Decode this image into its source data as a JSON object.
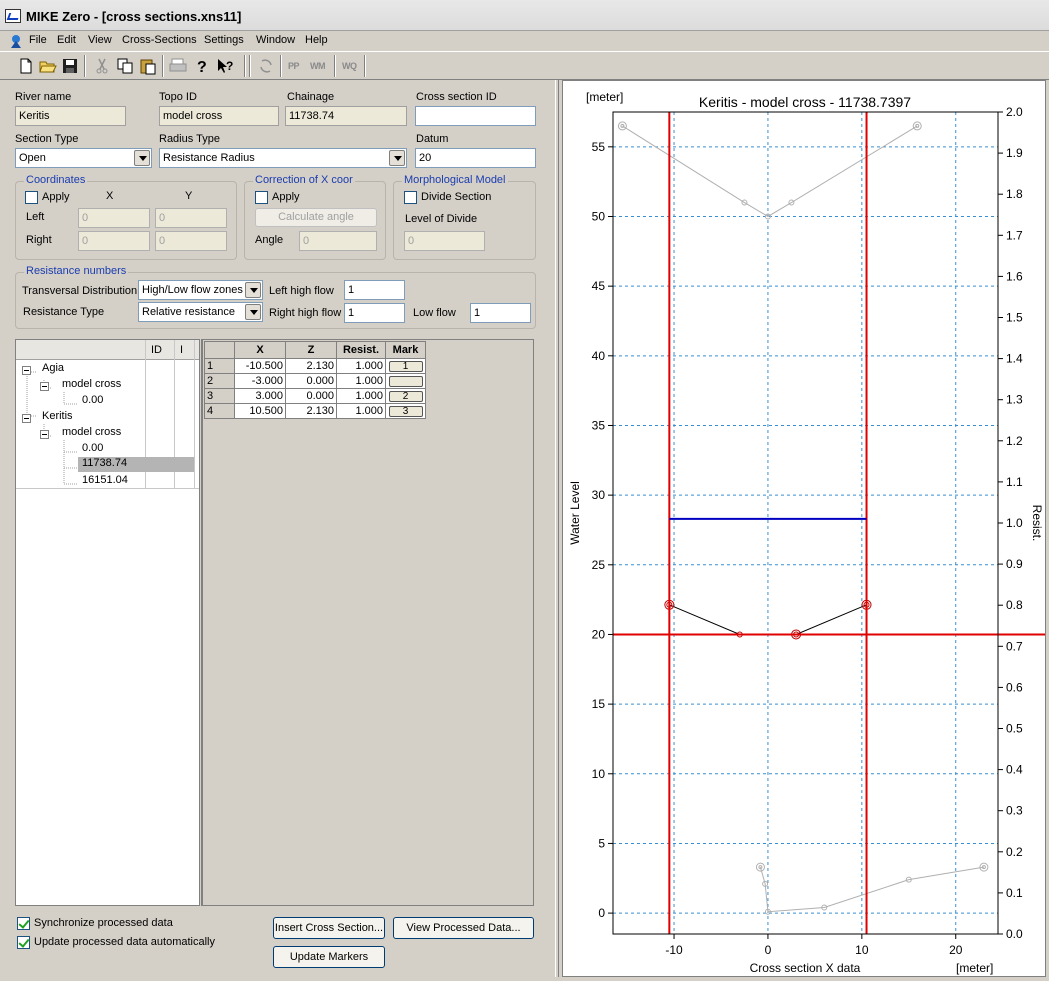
{
  "window": {
    "title": "MIKE Zero - [cross sections.xns11]"
  },
  "menu": [
    "File",
    "Edit",
    "View",
    "Cross-Sections",
    "Settings",
    "Window",
    "Help"
  ],
  "toolbar": {
    "labels": [
      "PP",
      "WM",
      "WQ"
    ]
  },
  "form": {
    "river_name": {
      "label": "River name",
      "value": "Keritis"
    },
    "topo_id": {
      "label": "Topo ID",
      "value": "model cross"
    },
    "chainage": {
      "label": "Chainage",
      "value": "11738.74"
    },
    "cross_section_id": {
      "label": "Cross section ID",
      "value": ""
    },
    "section_type": {
      "label": "Section Type",
      "value": "Open"
    },
    "radius_type": {
      "label": "Radius Type",
      "value": "Resistance Radius"
    },
    "datum": {
      "label": "Datum",
      "value": "20"
    }
  },
  "coordinates": {
    "title": "Coordinates",
    "apply": "Apply",
    "x_head": "X",
    "y_head": "Y",
    "left": "Left",
    "right": "Right",
    "left_x": "0",
    "left_y": "0",
    "right_x": "0",
    "right_y": "0"
  },
  "correction": {
    "title": "Correction of X coor",
    "apply": "Apply",
    "calc_btn": "Calculate angle",
    "angle_label": "Angle",
    "angle_value": "0"
  },
  "morph": {
    "title": "Morphological Model",
    "divide": "Divide Section",
    "level_label": "Level of Divide",
    "level_value": "0"
  },
  "resistance": {
    "title": "Resistance numbers",
    "transversal_label": "Transversal Distribution",
    "transversal_value": "High/Low flow zones",
    "type_label": "Resistance Type",
    "type_value": "Relative resistance",
    "left_high_label": "Left high flow",
    "left_high_value": "1",
    "right_high_label": "Right high flow",
    "right_high_value": "1",
    "low_label": "Low flow",
    "low_value": "1"
  },
  "tree": {
    "col_id": "ID",
    "col_i": "I",
    "nodes": [
      {
        "label": "Agia"
      },
      {
        "label": "model cross"
      },
      {
        "label": "0.00"
      },
      {
        "label": "Keritis"
      },
      {
        "label": "model cross"
      },
      {
        "label": "0.00"
      },
      {
        "label": "11738.74"
      },
      {
        "label": "16151.04"
      }
    ]
  },
  "table": {
    "headers": [
      "X",
      "Z",
      "Resist.",
      "Mark"
    ],
    "rows": [
      {
        "n": "1",
        "x": "-10.500",
        "z": "2.130",
        "r": "1.000",
        "mark": "1"
      },
      {
        "n": "2",
        "x": "-3.000",
        "z": "0.000",
        "r": "1.000",
        "mark": ""
      },
      {
        "n": "3",
        "x": "3.000",
        "z": "0.000",
        "r": "1.000",
        "mark": "2"
      },
      {
        "n": "4",
        "x": "10.500",
        "z": "2.130",
        "r": "1.000",
        "mark": "3"
      }
    ]
  },
  "options": {
    "sync": "Synchronize processed data",
    "update": "Update processed data automatically"
  },
  "buttons": {
    "insert": "Insert Cross Section...",
    "view": "View Processed Data...",
    "update_markers": "Update Markers"
  },
  "chart_data": {
    "type": "line",
    "title": "Keritis - model cross - 11738.7397",
    "xlabel": "Cross section X data",
    "xunit": "[meter]",
    "ylabel": "Water Level",
    "yunit": "[meter]",
    "y2label": "Resist.",
    "xlim": [
      -16.5,
      24.5
    ],
    "ylim": [
      -1.5,
      57.5
    ],
    "y2lim": [
      0.0,
      2.0
    ],
    "xticks": [
      -10,
      0,
      10,
      20
    ],
    "yticks": [
      0,
      5,
      10,
      15,
      20,
      25,
      30,
      35,
      40,
      45,
      50,
      55
    ],
    "y2ticks": [
      "0.0",
      "0.1",
      "0.2",
      "0.3",
      "0.4",
      "0.5",
      "0.6",
      "0.7",
      "0.8",
      "0.9",
      "1.0",
      "1.1",
      "1.2",
      "1.3",
      "1.4",
      "1.5",
      "1.6",
      "1.7",
      "1.8",
      "1.9",
      "2.0"
    ],
    "grid": true,
    "series": [
      {
        "role": "section",
        "color": "#000000",
        "marker": "circle",
        "points": [
          [
            -10.5,
            22.13
          ],
          [
            -3.0,
            20.0
          ],
          [
            3.0,
            20.0
          ],
          [
            10.5,
            22.13
          ]
        ]
      },
      {
        "role": "resistance-upper",
        "color": "#b0b0b0",
        "marker": "circle",
        "points": [
          [
            -15.5,
            56.5
          ],
          [
            -2.5,
            51.0
          ],
          [
            0.0,
            50.0
          ],
          [
            2.5,
            51.0
          ],
          [
            15.9,
            56.5
          ]
        ]
      },
      {
        "role": "resistance-lower",
        "color": "#b0b0b0",
        "marker": "circle",
        "points": [
          [
            -0.8,
            3.3
          ],
          [
            -0.3,
            2.1
          ],
          [
            0.0,
            0.1
          ],
          [
            6.0,
            0.4
          ],
          [
            15.0,
            2.4
          ],
          [
            23.0,
            3.3
          ]
        ]
      }
    ],
    "markers": {
      "left_x": -10.5,
      "right_x": 10.5,
      "datum_y": 20.0,
      "water_level_y": 28.3
    },
    "colors": {
      "marker": "#e00000",
      "water": "#0000c0",
      "grid": "#3a8fd0"
    }
  }
}
